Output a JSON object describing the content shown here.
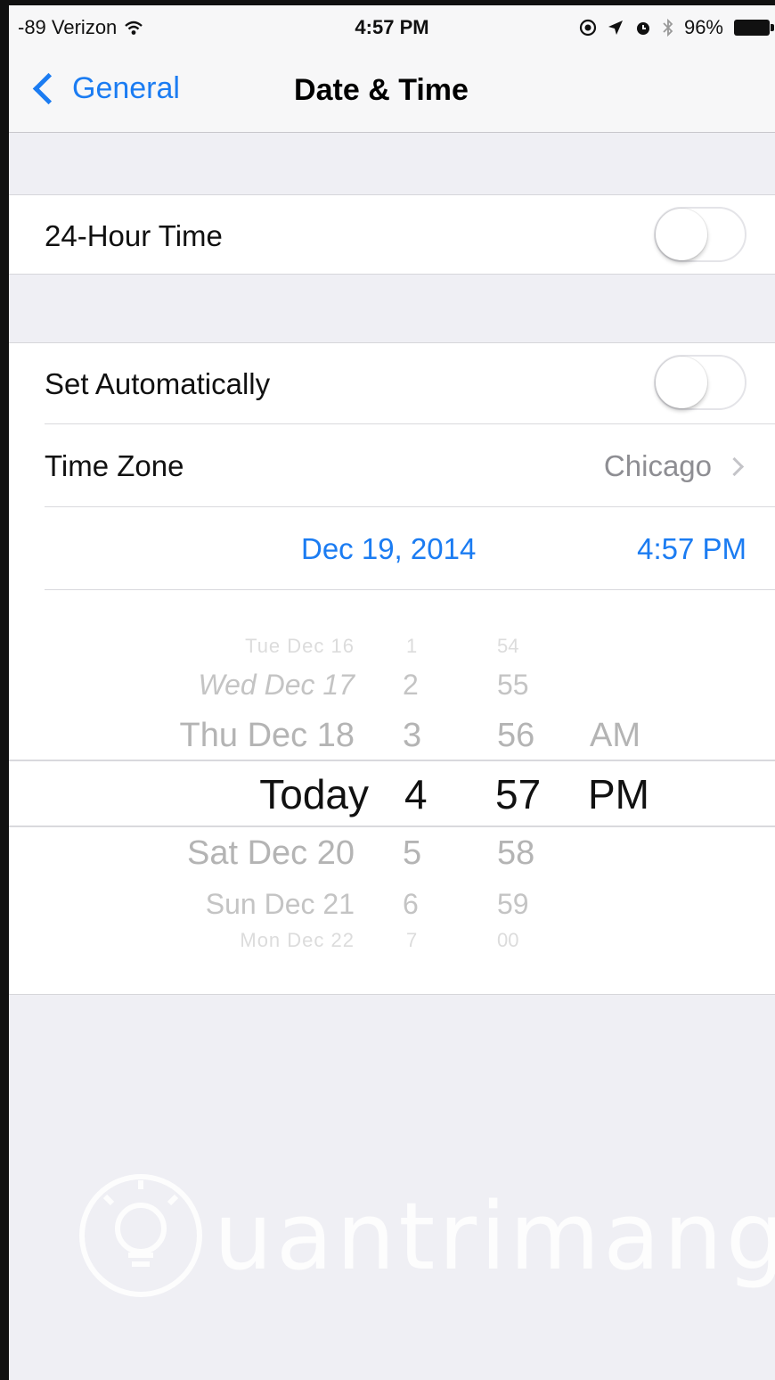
{
  "status_bar": {
    "carrier": "-89 Verizon",
    "time": "4:57 PM",
    "battery": "96%"
  },
  "nav": {
    "back_label": "General",
    "title": "Date & Time"
  },
  "settings": {
    "hour24": {
      "label": "24-Hour Time",
      "on": false
    },
    "set_auto": {
      "label": "Set Automatically",
      "on": false
    },
    "time_zone": {
      "label": "Time Zone",
      "value": "Chicago"
    },
    "current_date": "Dec 19, 2014",
    "current_time": "4:57 PM"
  },
  "picker": {
    "dates": [
      "Tue Dec 16",
      "Wed Dec 17",
      "Thu Dec 18",
      "Today",
      "Sat Dec 20",
      "Sun Dec 21",
      "Mon Dec 22"
    ],
    "hours": [
      "1",
      "2",
      "3",
      "4",
      "5",
      "6",
      "7"
    ],
    "minutes": [
      "54",
      "55",
      "56",
      "57",
      "58",
      "59",
      "00"
    ],
    "ampm": [
      "AM",
      "PM"
    ]
  },
  "watermark": {
    "text": "uantrimang"
  },
  "colors": {
    "accent": "#1b7cf2",
    "background": "#efeff4"
  }
}
